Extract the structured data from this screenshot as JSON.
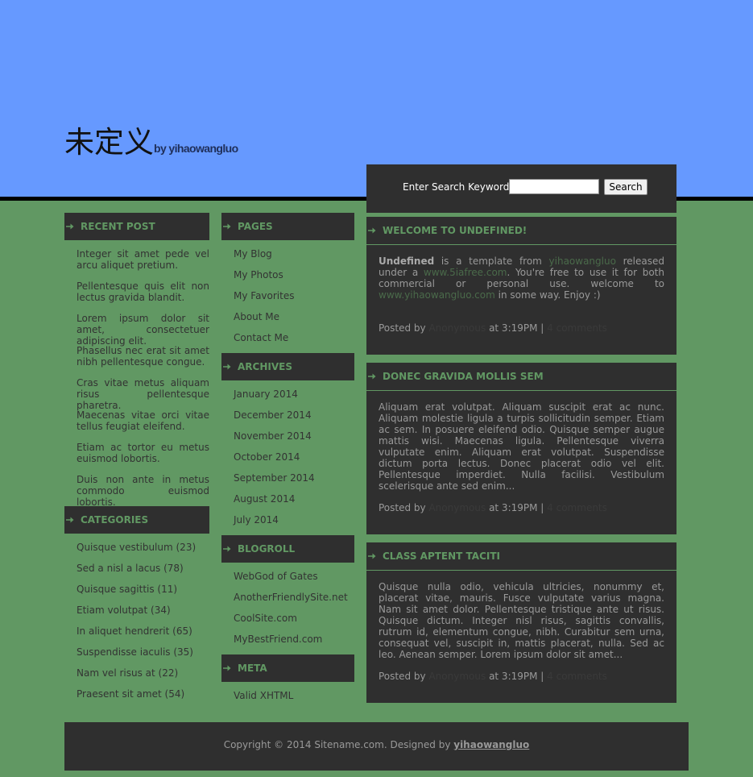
{
  "site": {
    "title": "未定义",
    "byline": "by yihaowangluo"
  },
  "search": {
    "label": "Enter Search Keyword:",
    "placeholder": "",
    "button": "Search"
  },
  "recent_post": {
    "heading": "RECENT POST",
    "items": [
      "Integer sit amet pede vel arcu aliquet pretium.",
      "Pellentesque quis elit non lectus gravida blandit.",
      "Lorem ipsum dolor sit amet, consectetuer adipiscing elit.",
      "Phasellus nec erat sit amet nibh pellentesque congue.",
      "Cras vitae metus aliquam risus pellentesque pharetra.",
      "Maecenas vitae orci vitae tellus feugiat eleifend.",
      "Etiam ac tortor eu metus euismod lobortis.",
      "Duis non ante in metus commodo euismod lobortis."
    ]
  },
  "categories": {
    "heading": "CATEGORIES",
    "items": [
      "Quisque vestibulum (23)",
      "Sed a nisl a lacus (78)",
      "Quisque sagittis (11)",
      "Etiam volutpat (34)",
      "In aliquet hendrerit (65)",
      "Suspendisse iaculis (35)",
      "Nam vel risus at (22)",
      "Praesent sit amet (54)"
    ]
  },
  "pages": {
    "heading": "PAGES",
    "items": [
      "My Blog",
      "My Photos",
      "My Favorites",
      "About Me",
      "Contact Me"
    ]
  },
  "archives": {
    "heading": "ARCHIVES",
    "items": [
      "January 2014",
      "December 2014",
      "November 2014",
      "October 2014",
      "September 2014",
      "August 2014",
      "July 2014"
    ]
  },
  "blogroll": {
    "heading": "BLOGROLL",
    "items": [
      "WebGod of Gates",
      "AnotherFriendlySite.net",
      "CoolSite.com",
      "MyBestFriend.com"
    ]
  },
  "meta": {
    "heading": "META",
    "items": [
      "Valid XHTML"
    ]
  },
  "posts": [
    {
      "title": "WELCOME TO UNDEFINED!",
      "bold": "Undefined",
      "t1": " is a template from ",
      "link1": "yihaowangluo",
      "t2": " released under a ",
      "link2": "www.5iafree.com",
      "t3": ". You're free to use it for both commercial or personal use. welcome to ",
      "link3": "www.yihaowangluo.com",
      "t4": " in some way. Enjoy :)",
      "posted_by": "Posted by",
      "author": "Anonymous",
      "time": "at 3:19PM |",
      "comments": "4 comments"
    },
    {
      "title": "DONEC GRAVIDA MOLLIS SEM",
      "body": "Aliquam erat volutpat. Aliquam suscipit erat ac nunc. Aliquam molestie ligula a turpis sollicitudin semper. Etiam ac sem. In posuere eleifend odio. Quisque semper augue mattis wisi. Maecenas ligula. Pellentesque viverra vulputate enim. Aliquam erat volutpat. Suspendisse dictum porta lectus. Donec placerat odio vel elit. Pellentesque imperdiet. Nulla facilisi. Vestibulum scelerisque ante sed enim...",
      "posted_by": "Posted by",
      "author": "Anonymous",
      "time": "at 3:19PM |",
      "comments": "4 comments"
    },
    {
      "title": "CLASS APTENT TACITI",
      "body": "Quisque nulla odio, vehicula ultricies, nonummy et, placerat vitae, mauris. Fusce vulputate varius magna. Nam sit amet dolor. Pellentesque tristique ante ut risus. Quisque dictum. Integer nisl risus, sagittis convallis, rutrum id, elementum congue, nibh. Curabitur sem urna, consequat vel, suscipit in, mattis placerat, nulla. Sed ac leo. Aenean semper. Lorem ipsum dolor sit amet...",
      "posted_by": "Posted by",
      "author": "Anonymous",
      "time": "at 3:19PM |",
      "comments": "4 comments"
    }
  ],
  "footer": {
    "text": "Copyright © 2014 Sitename.com. Designed by ",
    "link": "yihaowangluo"
  },
  "colors": {
    "background": "#619863",
    "header": "#6699ff",
    "panel": "#2f2f2f",
    "accent": "#619863"
  }
}
